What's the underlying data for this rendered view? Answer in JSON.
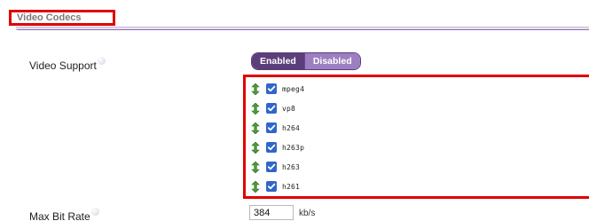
{
  "section": {
    "title": "Video Codecs"
  },
  "video_support": {
    "label": "Video Support",
    "toggle": {
      "enabled_label": "Enabled",
      "disabled_label": "Disabled",
      "selected": "Enabled"
    }
  },
  "codecs": [
    {
      "name": "mpeg4",
      "checked": true
    },
    {
      "name": "vp8",
      "checked": true
    },
    {
      "name": "h264",
      "checked": true
    },
    {
      "name": "h263p",
      "checked": true
    },
    {
      "name": "h263",
      "checked": true
    },
    {
      "name": "h261",
      "checked": true
    }
  ],
  "max_bit_rate": {
    "label": "Max Bit Rate",
    "value": "384",
    "unit": "kb/s"
  },
  "colors": {
    "highlight": "#e00000",
    "accent": "#5c3f7a",
    "checkbox": "#2f66c9",
    "move_arrow": "#4a9a3a"
  }
}
